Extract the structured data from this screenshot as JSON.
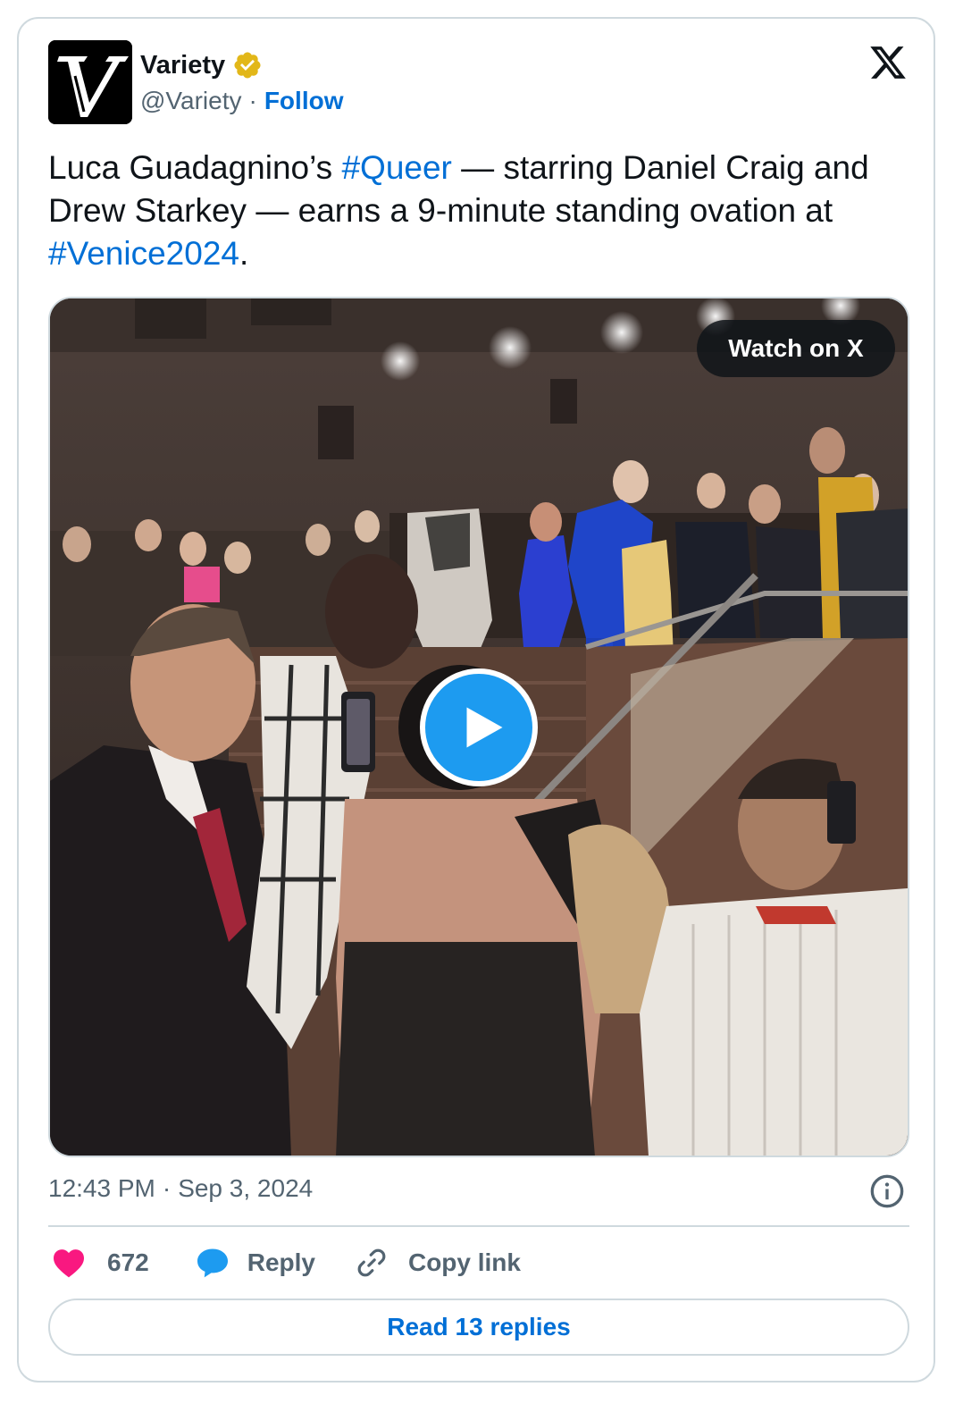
{
  "account": {
    "name": "Variety",
    "handle": "@Variety",
    "separator": "·",
    "follow_label": "Follow",
    "avatar_icon": "variety-v-logo",
    "verified_icon": "verified-gold-badge"
  },
  "brand_icon": "x-logo",
  "tweet": {
    "text_part1": "Luca Guadagnino’s ",
    "hashtag1": "#Queer",
    "text_part2": " — starring Daniel Craig and Drew Starkey — earns a 9-minute standing ovation at ",
    "hashtag2": "#Venice2024",
    "text_part3": "."
  },
  "media": {
    "type": "video",
    "watch_label": "Watch on X",
    "play_icon": "play-icon"
  },
  "meta": {
    "time": "12:43 PM",
    "separator": "·",
    "date": "Sep 3, 2024",
    "info_icon": "info-icon"
  },
  "actions": {
    "likes": "672",
    "reply_label": "Reply",
    "copy_label": "Copy link"
  },
  "read_replies_label": "Read 13 replies",
  "colors": {
    "link": "#006fd6",
    "text": "#0f1419",
    "muted": "#536471",
    "border": "#cfd9de",
    "like": "#f91880",
    "reply": "#1d9bf0",
    "play": "#1d9bf0",
    "verified": "#e2b719"
  }
}
